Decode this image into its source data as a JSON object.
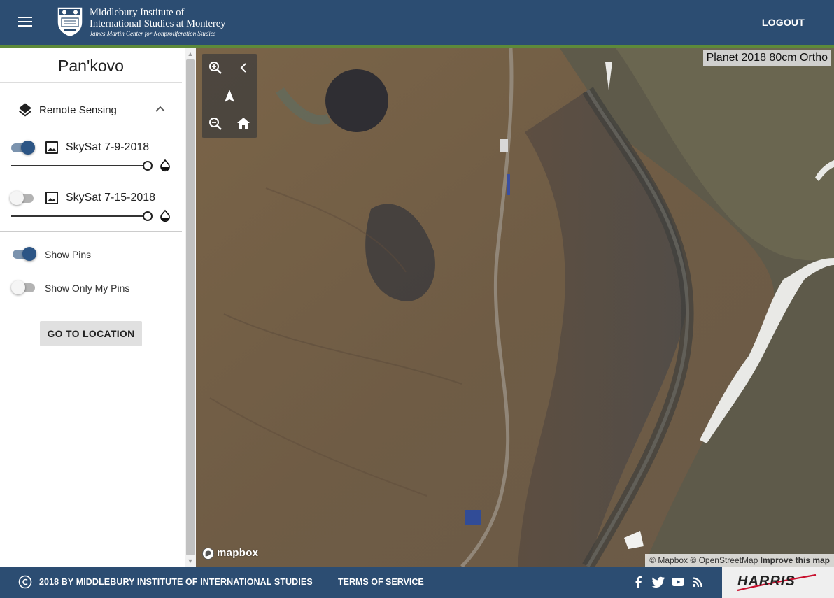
{
  "header": {
    "logo_line1": "Middlebury Institute of",
    "logo_line2": "International Studies at Monterey",
    "logo_line3": "James Martin Center for Nonproliferation Studies",
    "logout_label": "LOGOUT"
  },
  "sidebar": {
    "title": "Pan'kovo",
    "remote_sensing": {
      "label": "Remote Sensing",
      "expanded": true,
      "layers": [
        {
          "label": "SkySat 7-9-2018",
          "enabled": true,
          "opacity": 1.0
        },
        {
          "label": "SkySat 7-15-2018",
          "enabled": false,
          "opacity": 1.0
        }
      ]
    },
    "show_pins": {
      "label": "Show Pins",
      "enabled": true
    },
    "show_only_my_pins": {
      "label": "Show Only My Pins",
      "enabled": false
    },
    "go_to_location_label": "GO TO LOCATION"
  },
  "map": {
    "basemap_label": "Planet 2018 80cm Ortho",
    "mapbox_logo_text": "mapbox",
    "attribution": {
      "mapbox": "© Mapbox",
      "osm": "© OpenStreetMap",
      "improve": "Improve this map"
    },
    "controls": [
      "zoom-in-icon",
      "collapse-icon",
      "compass-icon",
      "zoom-out-icon",
      "home-icon"
    ]
  },
  "footer": {
    "copyright": "2018 BY MIDDLEBURY INSTITUTE OF INTERNATIONAL STUDIES",
    "terms_label": "TERMS OF SERVICE",
    "social": [
      "facebook-icon",
      "twitter-icon",
      "youtube-icon",
      "rss-icon"
    ],
    "partner_logo": "HARRIS"
  },
  "colors": {
    "primary": "#2c4d72",
    "accent_stripe": "#5d8a3a",
    "toggle_on": "#2c5585"
  }
}
